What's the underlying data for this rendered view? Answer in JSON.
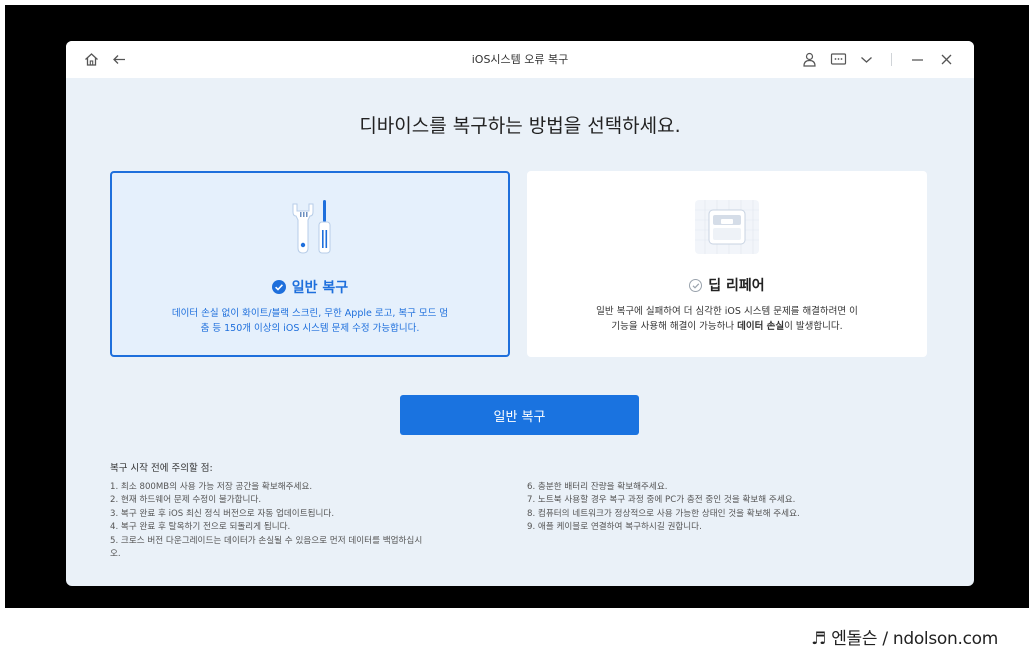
{
  "window": {
    "title": "iOS시스템 오류 복구"
  },
  "titlebar": {
    "icons": [
      "home-icon",
      "back-arrow-icon",
      "user-icon",
      "feedback-icon",
      "chevron-down-icon",
      "minimize-icon",
      "close-icon"
    ]
  },
  "main": {
    "heading": "디바이스를 복구하는 방법을 선택하세요.",
    "options": [
      {
        "label": "일반 복구",
        "selected": true,
        "icon": "tools-icon",
        "desc_line1": "데이터 손실 없이 화이트/블랙 스크린, 무한 Apple 로고, 복구 모드 멈",
        "desc_line2": "춤 등 150개 이상의 iOS 시스템 문제 수정 가능합니다."
      },
      {
        "label": "딥 리페어",
        "selected": false,
        "icon": "device-repair-icon",
        "desc_line1": "일반 복구에 실패하여 더 심각한 iOS 시스템 문제를 해결하려면 이",
        "desc_line2_a": "기능을 사용해 해결이 가능하나 ",
        "desc_line2_b": "데이터 손실",
        "desc_line2_c": "이 발생합니다."
      }
    ],
    "primary_button": "일반 복구"
  },
  "notes": {
    "title": "복구 시작 전에 주의할 점:",
    "left": [
      "1.  최소 800MB의 사용 가능 저장 공간을 확보해주세요.",
      "2.  현재 하드웨어 문제 수정이 불가합니다.",
      "3.  복구 완료 후 iOS 최신 정식 버전으로 자동 업데이트됩니다.",
      "4.  복구 완료 후 탈옥하기 전으로 되돌리게 됩니다.",
      "5.  크로스 버전 다운그레이드는 데이터가 손실될 수 있음으로 먼저 데이터를 백업하십시",
      "오."
    ],
    "right": [
      "6.  충분한 배터리 잔량을 확보해주세요.",
      "7.  노트북 사용할 경우 복구 과정 중에 PC가 충전 중인 것을 확보해 주세요.",
      "8.  컴퓨터의 네트워크가 정상적으로 사용 가능한 상태인 것을 확보해 주세요.",
      "9.  애플 케이블로 연결하여 복구하시길 권합니다."
    ]
  },
  "watermark": {
    "text": "♬ 엔돌슨 / ndolson.com"
  },
  "colors": {
    "accent": "#1e6fdc",
    "window_bg": "#eaf1f8",
    "selected_card_bg": "#e5f0fc"
  }
}
